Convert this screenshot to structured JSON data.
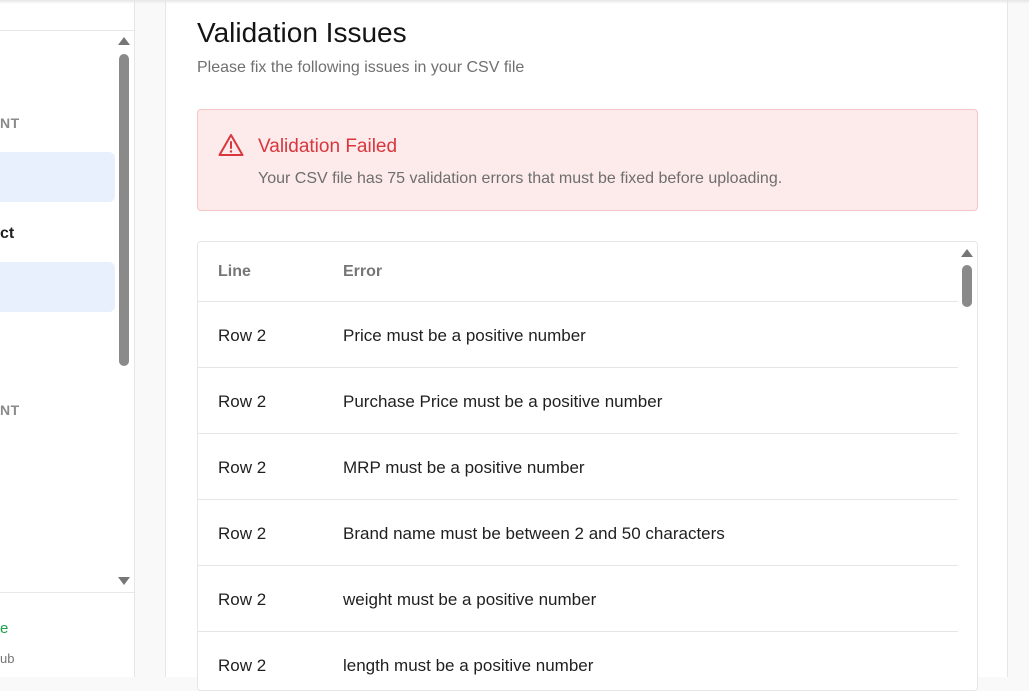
{
  "sidebar": {
    "section_1_label": "NT",
    "section_2_label": "NT",
    "nav_item_text": "ct",
    "status_text": "e",
    "sub_text": "ub"
  },
  "main": {
    "title": "Validation Issues",
    "subtitle": "Please fix the following issues in your CSV file"
  },
  "alert": {
    "icon": "warning-triangle-icon",
    "title": "Validation Failed",
    "message": "Your CSV file has 75 validation errors that must be fixed before uploading.",
    "color": "#d9363e",
    "background": "#fdeaea"
  },
  "table": {
    "columns": [
      "Line",
      "Error"
    ],
    "rows": [
      {
        "line": "Row 2",
        "error": "Price must be a positive number"
      },
      {
        "line": "Row 2",
        "error": "Purchase Price must be a positive number"
      },
      {
        "line": "Row 2",
        "error": "MRP must be a positive number"
      },
      {
        "line": "Row 2",
        "error": "Brand name must be between 2 and 50 characters"
      },
      {
        "line": "Row 2",
        "error": "weight must be a positive number"
      },
      {
        "line": "Row 2",
        "error": "length must be a positive number"
      }
    ]
  }
}
